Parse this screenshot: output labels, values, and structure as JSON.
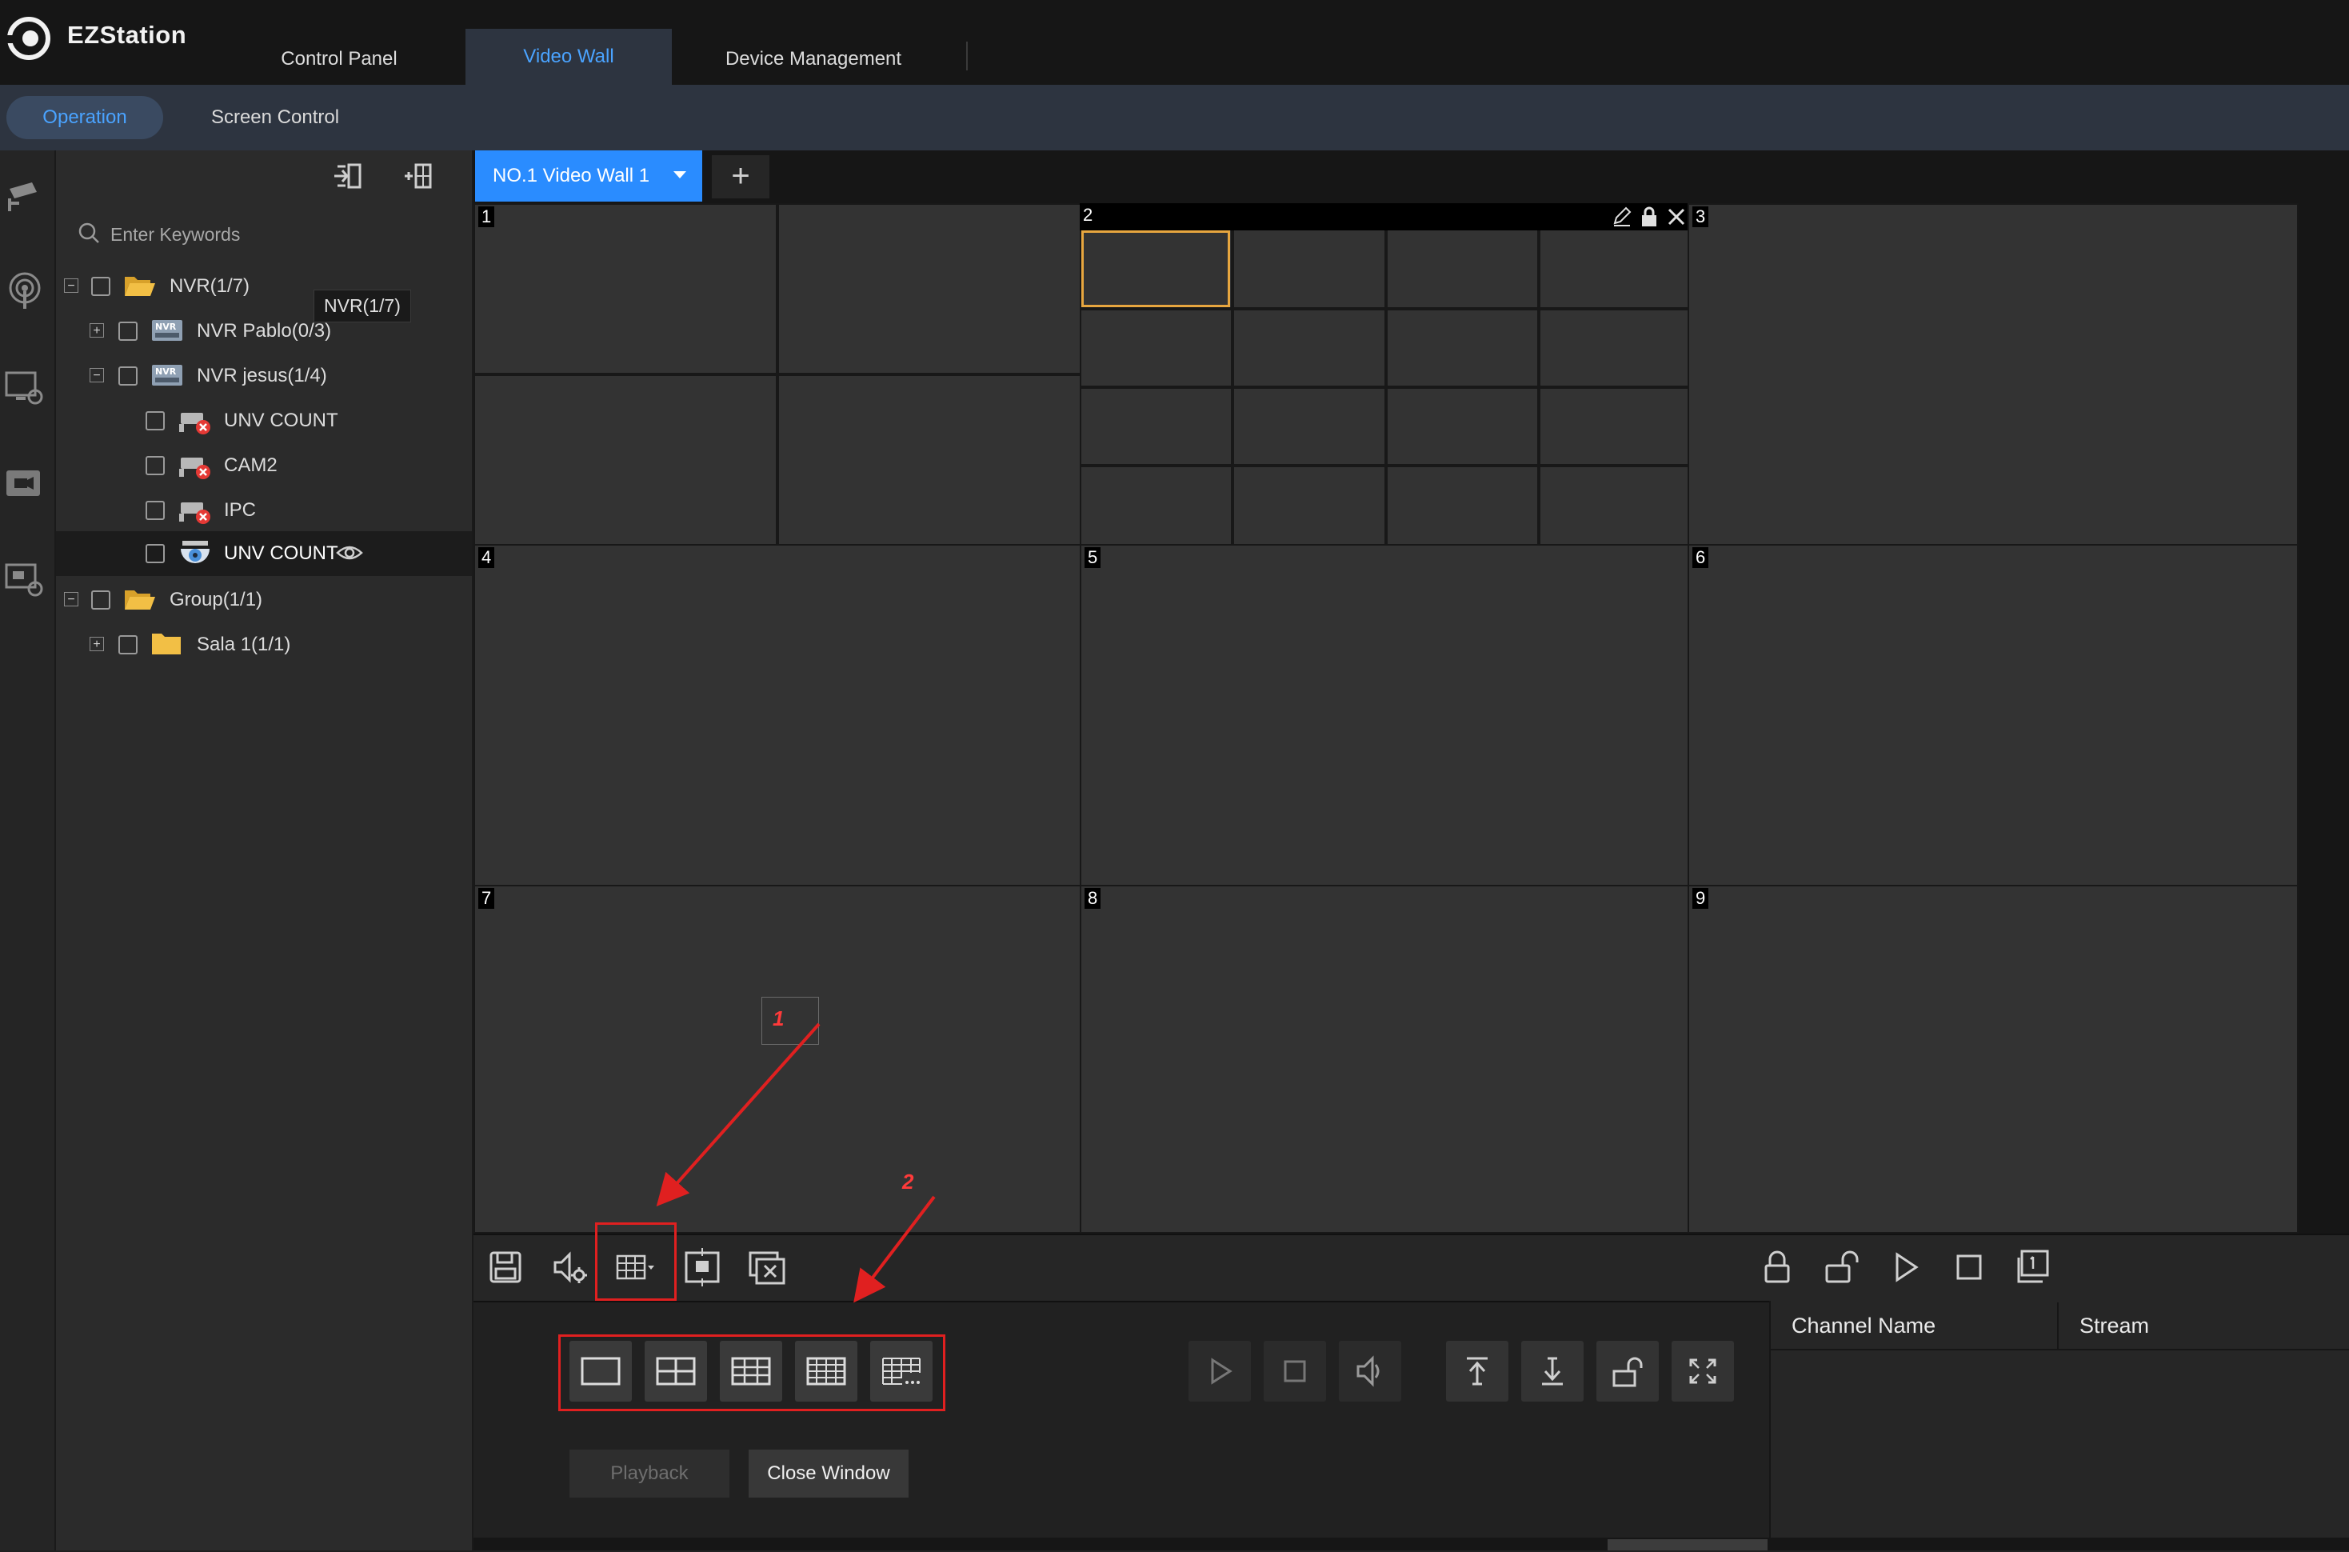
{
  "app": {
    "title": "EZStation"
  },
  "tabs": [
    {
      "label": "Control Panel",
      "active": false
    },
    {
      "label": "Video Wall",
      "active": true
    },
    {
      "label": "Device Management",
      "active": false
    }
  ],
  "subtabs": [
    {
      "label": "Operation",
      "active": true
    },
    {
      "label": "Screen Control",
      "active": false
    }
  ],
  "left_rail": {
    "icons": [
      "camera-icon",
      "signal-icon",
      "monitor-refresh-icon",
      "video-icon",
      "monitor-camera-icon"
    ]
  },
  "device_panel": {
    "tools": [
      "import-icon",
      "layout-add-icon"
    ],
    "search": {
      "placeholder": "Enter Keywords",
      "value": ""
    },
    "tree": [
      {
        "label": "NVR(1/7)",
        "expanded": true,
        "icon": "folder-open-icon"
      },
      {
        "label": "NVR Pablo(0/3)",
        "expanded": false,
        "icon": "nvr-icon"
      },
      {
        "label": "NVR jesus(1/4)",
        "expanded": true,
        "icon": "nvr-icon"
      },
      {
        "label": "UNV COUNT",
        "icon": "camera-offline-icon"
      },
      {
        "label": "CAM2",
        "icon": "camera-offline-icon"
      },
      {
        "label": "IPC",
        "icon": "camera-offline-icon"
      },
      {
        "label": "UNV COUNT",
        "icon": "dome-camera-icon",
        "selected": true
      },
      {
        "label": "Group(1/1)",
        "expanded": true,
        "icon": "folder-open-icon"
      },
      {
        "label": "Sala 1(1/1)",
        "expanded": false,
        "icon": "folder-icon"
      }
    ],
    "tooltip": "NVR(1/7)"
  },
  "video_wall": {
    "tab_label": "NO.1 Video Wall 1",
    "add_tab_label": "+",
    "screens": [
      "1",
      "2",
      "3",
      "4",
      "5",
      "6",
      "7",
      "8",
      "9"
    ]
  },
  "toolbar": {
    "left": [
      "save-icon",
      "audio-settings-icon",
      "split-layout-icon",
      "fit-window-icon",
      "close-all-windows-icon"
    ],
    "right": [
      "lock-icon",
      "unlock-icon",
      "play-icon",
      "stop-icon",
      "scene-icon"
    ]
  },
  "bottom": {
    "layouts": [
      "1-split-icon",
      "4-split-icon",
      "9-split-icon",
      "16-split-icon",
      "more-split-icon"
    ],
    "controls": [
      "play-icon",
      "stop-icon",
      "audio-icon",
      "bring-to-front-icon",
      "send-to-back-icon",
      "unlock-icon",
      "fullscreen-icon"
    ],
    "playback_label": "Playback",
    "close_window_label": "Close Window",
    "columns": [
      "Channel Name",
      "Stream"
    ]
  },
  "annotations": [
    "1",
    "2"
  ],
  "colors": {
    "accent": "#2a8cff",
    "active_text": "#4aa3ff",
    "selection": "#e7a63f",
    "annotation": "#e02020"
  }
}
